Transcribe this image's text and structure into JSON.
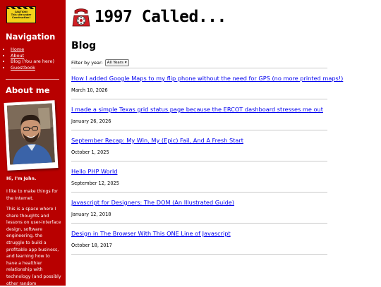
{
  "sidebar": {
    "sign": {
      "line1": "CAUTION!",
      "line2": "This site under",
      "line3": "Construction!"
    },
    "nav_heading": "Navigation",
    "nav_items": [
      {
        "label": "Home"
      },
      {
        "label": "About"
      },
      {
        "label": "Blog (You are here)"
      },
      {
        "label": "Guestbook"
      }
    ],
    "about_heading": "About me",
    "greeting": "Hi, I'm John.",
    "intro": "I like to make things for the Internet.",
    "bio": "This is a space where I share thoughts and lessons on user-interface design, software engineering, the struggle to build a profitable app business, and learning how to have a healthier relationship with technology (and possibly other random"
  },
  "header": {
    "title": "1997 Called..."
  },
  "main": {
    "heading": "Blog",
    "filter_label": "Filter by year:",
    "filter_value": "All Years",
    "posts": [
      {
        "title": "How I added Google Maps to my flip phone without the need for GPS (no more printed maps!)",
        "date": "March 10, 2026"
      },
      {
        "title": "I made a simple Texas grid status page because the ERCOT dashboard stresses me out",
        "date": "January 26, 2026"
      },
      {
        "title": "September Recap: My Win, My (Epic) Fail, And A Fresh Start",
        "date": "October 1, 2025"
      },
      {
        "title": "Hello PHP World",
        "date": "September 12, 2025"
      },
      {
        "title": "Javascript for Designers: The DOM (An Illustrated Guide)",
        "date": "January 12, 2018"
      },
      {
        "title": "Design in The Browser With This ONE Line of Javascript",
        "date": "October 18, 2017"
      }
    ]
  },
  "colors": {
    "sidebar": "#b80000",
    "link": "#0000ee",
    "divider": "#c9c9c9"
  }
}
